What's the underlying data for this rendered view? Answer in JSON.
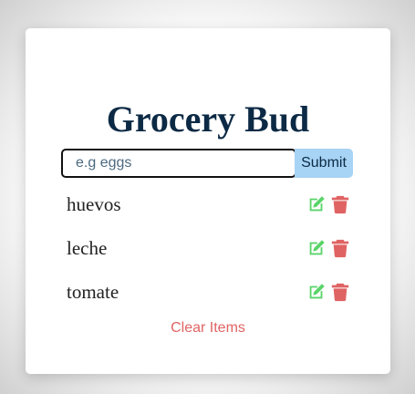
{
  "app": {
    "title": "Grocery Bud"
  },
  "form": {
    "input_value": "",
    "input_placeholder": "e.g eggs",
    "submit_label": "Submit"
  },
  "items": [
    {
      "name": "huevos",
      "edit_icon": "edit-icon",
      "delete_icon": "trash-icon"
    },
    {
      "name": "leche",
      "edit_icon": "edit-icon",
      "delete_icon": "trash-icon"
    },
    {
      "name": "tomate",
      "edit_icon": "edit-icon",
      "delete_icon": "trash-icon"
    }
  ],
  "clear_label": "Clear Items",
  "colors": {
    "title": "#0c2a45",
    "submit_bg": "#a7d3f4",
    "edit": "#5ad46a",
    "delete": "#e06363",
    "clear": "#e06363"
  }
}
